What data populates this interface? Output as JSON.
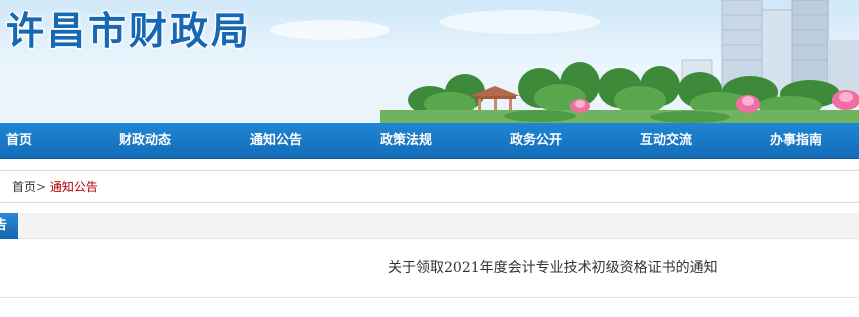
{
  "header": {
    "site_title": "许昌市财政局"
  },
  "nav": {
    "items": [
      {
        "label": "首页"
      },
      {
        "label": "财政动态"
      },
      {
        "label": "通知公告"
      },
      {
        "label": "政策法规"
      },
      {
        "label": "政务公开"
      },
      {
        "label": "互动交流"
      },
      {
        "label": "办事指南"
      }
    ]
  },
  "breadcrumb": {
    "home": "首页",
    "separator": ">",
    "current": "通知公告"
  },
  "section": {
    "tab_label": "告"
  },
  "article": {
    "title": "关于领取2021年度会计专业技术初级资格证书的通知"
  },
  "colors": {
    "title_blue": "#1668b5",
    "nav_blue": "#146cb9",
    "crumb_active": "#b30000"
  }
}
